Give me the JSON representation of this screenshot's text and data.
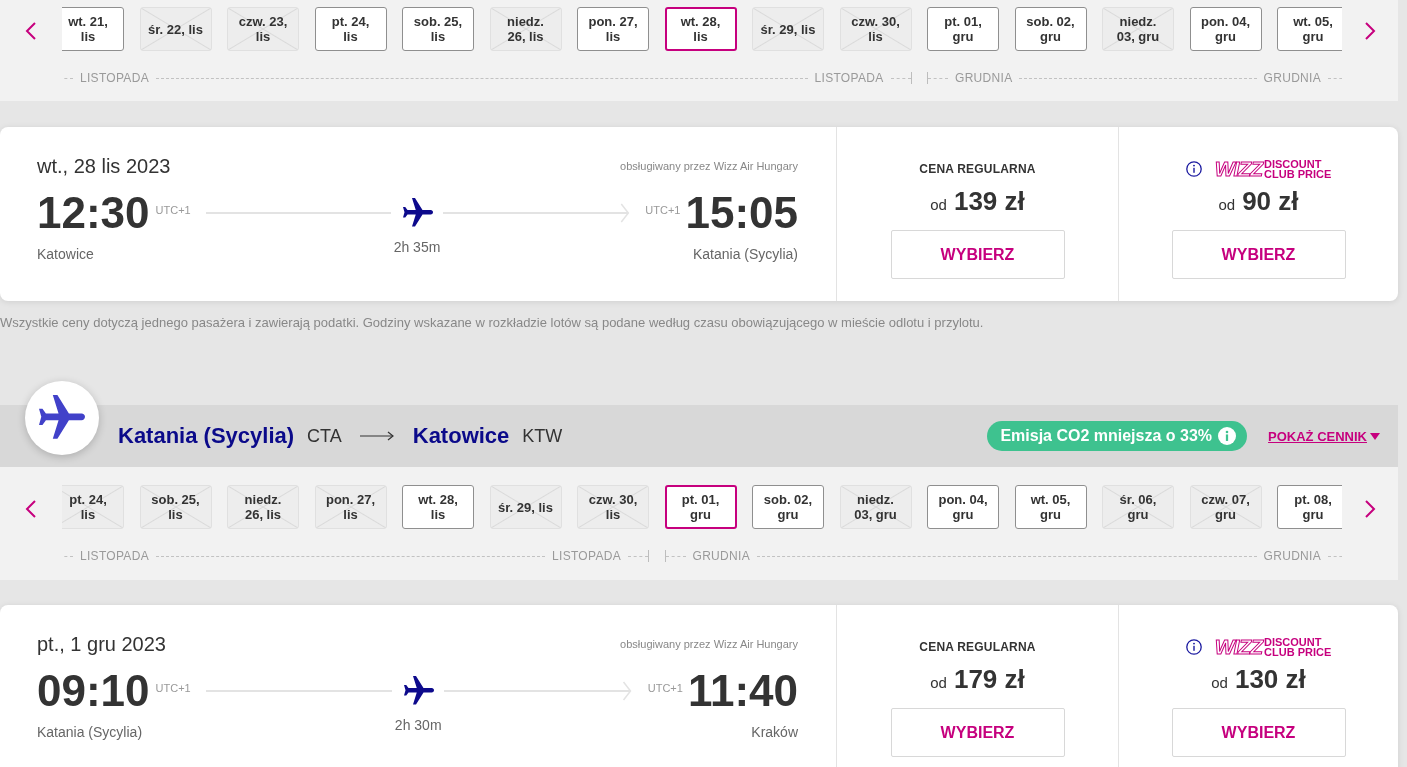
{
  "outbound_dates": {
    "months": [
      {
        "start_label": "LISTOPADA",
        "end_label": "LISTOPADA",
        "dates": [
          {
            "label": "wt. 21,\nlis",
            "available": true,
            "selected": false
          },
          {
            "label": "śr. 22, lis",
            "available": false,
            "selected": false
          },
          {
            "label": "czw. 23,\nlis",
            "available": false,
            "selected": false
          },
          {
            "label": "pt. 24,\nlis",
            "available": true,
            "selected": false
          },
          {
            "label": "sob. 25,\nlis",
            "available": true,
            "selected": false
          },
          {
            "label": "niedz.\n26, lis",
            "available": false,
            "selected": false
          },
          {
            "label": "pon. 27,\nlis",
            "available": true,
            "selected": false
          },
          {
            "label": "wt. 28,\nlis",
            "available": true,
            "selected": true
          },
          {
            "label": "śr. 29, lis",
            "available": false,
            "selected": false
          },
          {
            "label": "czw. 30,\nlis",
            "available": false,
            "selected": false
          }
        ]
      },
      {
        "start_label": "GRUDNIA",
        "end_label": "GRUDNIA",
        "dates": [
          {
            "label": "pt. 01,\ngru",
            "available": true,
            "selected": false
          },
          {
            "label": "sob. 02,\ngru",
            "available": true,
            "selected": false
          },
          {
            "label": "niedz.\n03, gru",
            "available": false,
            "selected": false
          },
          {
            "label": "pon. 04,\ngru",
            "available": true,
            "selected": false
          },
          {
            "label": "wt. 05,\ngru",
            "available": true,
            "selected": false
          }
        ]
      }
    ]
  },
  "outbound_flight": {
    "date": "wt., 28 lis 2023",
    "operator": "obsługiwany przez Wizz Air Hungary",
    "departure": {
      "time": "12:30",
      "timezone": "UTC+1",
      "city": "Katowice"
    },
    "duration": "2h 35m",
    "arrival": {
      "time": "15:05",
      "timezone": "UTC+1",
      "city": "Katania (Sycylia)"
    },
    "fares": [
      {
        "kind": "regular",
        "title": "CENA REGULARNA",
        "prefix": "od",
        "price": "139 zł",
        "button": "WYBIERZ"
      },
      {
        "kind": "club",
        "logo": {
          "wordmark": "WIZZ",
          "line_1": "DISCOUNT",
          "line_2": "CLUB **PRICE**"
        },
        "prefix": "od",
        "price": "90 zł",
        "button": "WYBIERZ"
      }
    ]
  },
  "price_note": "Wszystkie ceny dotyczą jednego pasażera i zawierają podatki. Godziny wskazane w rozkładzie lotów są podane według czasu obowiązującego w mieście odlotu i przylotu.",
  "return_header": {
    "origin": {
      "city": "Katania (Sycylia)",
      "code": "CTA"
    },
    "destination": {
      "city": "Katowice",
      "code": "KTW"
    },
    "co2_badge": "Emisja CO2 mniejsza o 33%",
    "price_list_link": "POKAŻ CENNIK"
  },
  "return_dates": {
    "months": [
      {
        "start_label": "LISTOPADA",
        "end_label": "LISTOPADA",
        "dates": [
          {
            "label": "pt. 24,\nlis",
            "available": false,
            "selected": false
          },
          {
            "label": "sob. 25,\nlis",
            "available": false,
            "selected": false
          },
          {
            "label": "niedz.\n26, lis",
            "available": false,
            "selected": false
          },
          {
            "label": "pon. 27,\nlis",
            "available": false,
            "selected": false
          },
          {
            "label": "wt. 28,\nlis",
            "available": true,
            "selected": false
          },
          {
            "label": "śr. 29, lis",
            "available": false,
            "selected": false
          },
          {
            "label": "czw. 30,\nlis",
            "available": false,
            "selected": false
          }
        ]
      },
      {
        "start_label": "GRUDNIA",
        "end_label": "GRUDNIA",
        "dates": [
          {
            "label": "pt. 01,\ngru",
            "available": true,
            "selected": true
          },
          {
            "label": "sob. 02,\ngru",
            "available": true,
            "selected": false
          },
          {
            "label": "niedz.\n03, gru",
            "available": false,
            "selected": false
          },
          {
            "label": "pon. 04,\ngru",
            "available": true,
            "selected": false
          },
          {
            "label": "wt. 05,\ngru",
            "available": true,
            "selected": false
          },
          {
            "label": "śr. 06,\ngru",
            "available": false,
            "selected": false
          },
          {
            "label": "czw. 07,\ngru",
            "available": false,
            "selected": false
          },
          {
            "label": "pt. 08,\ngru",
            "available": true,
            "selected": false
          }
        ]
      }
    ]
  },
  "return_flight": {
    "date": "pt., 1 gru 2023",
    "operator": "obsługiwany przez Wizz Air Hungary",
    "departure": {
      "time": "09:10",
      "timezone": "UTC+1",
      "city": "Katania (Sycylia)"
    },
    "duration": "2h 30m",
    "arrival": {
      "time": "11:40",
      "timezone": "UTC+1",
      "city": "Kraków"
    },
    "fares": [
      {
        "kind": "regular",
        "title": "CENA REGULARNA",
        "prefix": "od",
        "price": "179 zł",
        "button": "WYBIERZ"
      },
      {
        "kind": "club",
        "logo": {
          "wordmark": "WIZZ",
          "line_1": "DISCOUNT",
          "line_2": "CLUB **PRICE**"
        },
        "prefix": "od",
        "price": "130 zł",
        "button": "WYBIERZ"
      }
    ]
  }
}
